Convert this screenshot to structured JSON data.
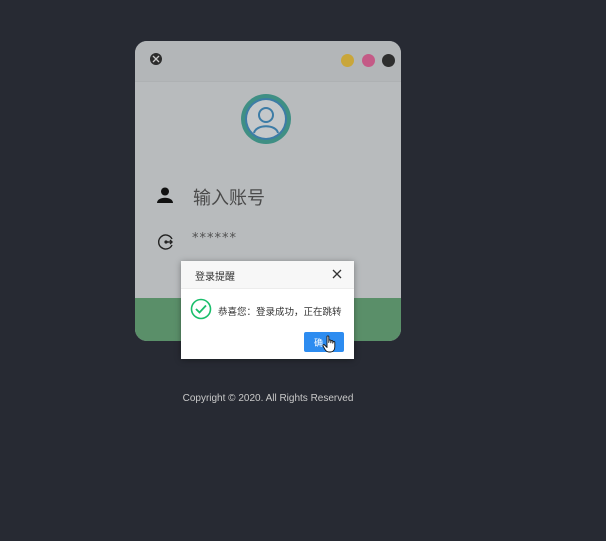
{
  "login": {
    "account_placeholder": "输入账号",
    "password_masked": "******"
  },
  "dialog": {
    "title": "登录提醒",
    "message": "恭喜您：登录成功，正在跳转",
    "confirm_label": "确"
  },
  "footer": {
    "copyright": "Copyright © 2020. All Rights Reserved"
  },
  "colors": {
    "background": "#272a33",
    "card": "#b8bbbd",
    "login_button": "#5a8f69",
    "confirm_button": "#2d8cf0",
    "success_check": "#19be6b"
  }
}
